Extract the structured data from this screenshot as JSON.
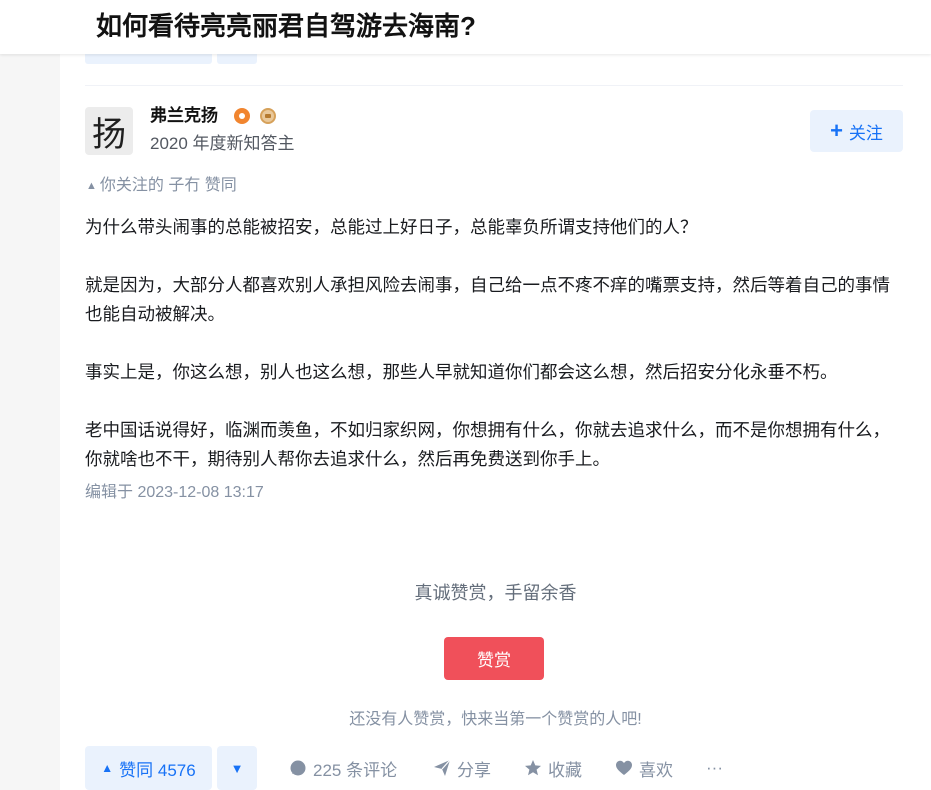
{
  "question": {
    "title": "如何看待亮亮丽君自驾游去海南?"
  },
  "author": {
    "avatar_char": "扬",
    "name": "弗兰克扬",
    "headline": "2020 年度新知答主",
    "follow_label": "关注"
  },
  "social": {
    "text": "你关注的 子冇 赞同"
  },
  "answer": {
    "paragraphs": [
      "为什么带头闹事的总能被招安，总能过上好日子，总能辜负所谓支持他们的人？",
      "就是因为，大部分人都喜欢别人承担风险去闹事，自己给一点不疼不痒的嘴票支持，然后等着自己的事情也能自动被解决。",
      "事实上是，你这么想，别人也这么想，那些人早就知道你们都会这么想，然后招安分化永垂不朽。",
      "老中国话说得好，临渊而羡鱼，不如归家织网，你想拥有什么，你就去追求什么，而不是你想拥有什么，你就啥也不干，期待别人帮你去追求什么，然后再免费送到你手上。"
    ],
    "edited": "编辑于 2023-12-08 13:17"
  },
  "reward": {
    "slogan": "真诚赞赏，手留余香",
    "button": "赞赏",
    "note": "还没有人赞赏，快来当第一个赞赏的人吧!"
  },
  "actions": {
    "vote_up": "赞同 4576",
    "comments": "225 条评论",
    "share": "分享",
    "collect": "收藏",
    "like": "喜欢",
    "more": "···"
  },
  "colors": {
    "accent": "#1772f6",
    "reward": "#f0505a",
    "muted": "#8591a3"
  }
}
